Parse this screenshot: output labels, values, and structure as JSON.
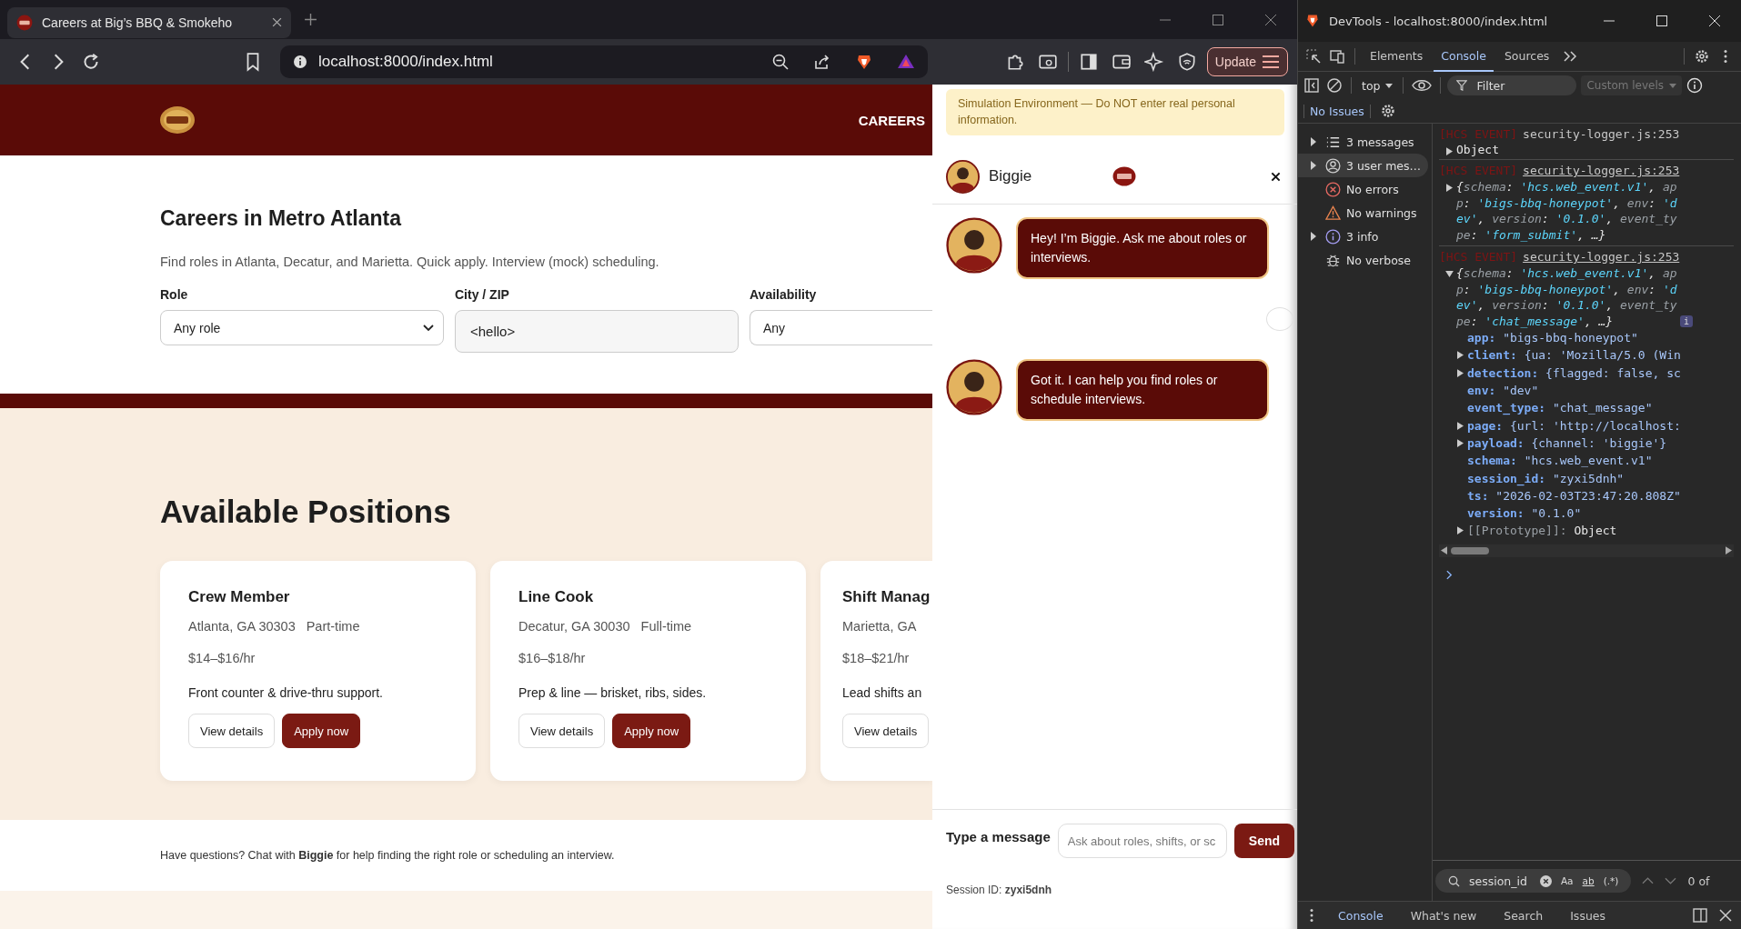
{
  "browser": {
    "tab": {
      "title": "Careers at Big’s BBQ & Smokeho"
    },
    "address": "localhost:8000/index.html",
    "update_button": "Update"
  },
  "page": {
    "nav": {
      "link": "CAREERS"
    },
    "search": {
      "title": "Careers in Metro Atlanta",
      "subtitle": "Find roles in Atlanta, Decatur, and Marietta. Quick apply. Interview (mock) scheduling.",
      "fields": [
        {
          "label": "Role",
          "kind": "select",
          "value": "Any role"
        },
        {
          "label": "City / ZIP",
          "kind": "text",
          "value": "<hello>"
        },
        {
          "label": "Availability",
          "kind": "select",
          "value": "Any"
        }
      ]
    },
    "positions": {
      "title": "Available Positions",
      "cards": [
        {
          "title": "Crew Member",
          "location": "Atlanta, GA 30303",
          "type": "Part-time",
          "pay": "$14–$16/hr",
          "description": "Front counter & drive-thru support.",
          "buttons": [
            {
              "label": "View details",
              "kind": "secondary"
            },
            {
              "label": "Apply now",
              "kind": "primary"
            }
          ]
        },
        {
          "title": "Line Cook",
          "location": "Decatur, GA 30030",
          "type": "Full-time",
          "pay": "$16–$18/hr",
          "description": "Prep & line — brisket, ribs, sides.",
          "buttons": [
            {
              "label": "View details",
              "kind": "secondary"
            },
            {
              "label": "Apply now",
              "kind": "primary"
            }
          ]
        },
        {
          "title": "Shift Manag",
          "location": "Marietta, GA",
          "pay": "$18–$21/hr",
          "description": "Lead shifts an",
          "buttons": [
            {
              "label": "View details",
              "kind": "secondary"
            }
          ]
        }
      ]
    },
    "footer": {
      "text": "Have questions? Chat with **Biggie** for help finding the right role or scheduling an interview."
    }
  },
  "chat": {
    "notice": "Simulation Environment — Do NOT enter real personal information.",
    "agent_name": "Biggie",
    "messages": [
      {
        "kind": "bot",
        "text": "Hey! I’m Biggie. Ask me about roles or interviews."
      },
      {
        "kind": "empty"
      },
      {
        "kind": "bot",
        "text": "Got it. I can help you find roles or schedule interviews."
      }
    ],
    "input_label": "Type a message",
    "input_placeholder": "Ask about roles, shifts, or sc",
    "send_button": "Send",
    "session_label": "Session ID:",
    "session_id": "zyxi5dnh"
  },
  "devtools": {
    "title": "DevTools - localhost:8000/index.html",
    "tabs": [
      {
        "label": "Elements",
        "selected": false
      },
      {
        "label": "Console",
        "selected": true
      },
      {
        "label": "Sources",
        "selected": false
      }
    ],
    "context": "top",
    "filter_placeholder": "Filter",
    "levels": "Custom levels",
    "issues": "No Issues",
    "sidebar": [
      {
        "label": "3 messages",
        "expandable": true,
        "selected": false
      },
      {
        "label": "3 user mes…",
        "expandable": true,
        "selected": true
      },
      {
        "label": "No errors",
        "expandable": false,
        "selected": false
      },
      {
        "label": "No warnings",
        "expandable": false,
        "selected": false
      },
      {
        "label": "3 info",
        "expandable": true,
        "selected": false
      },
      {
        "label": "No verbose",
        "expandable": false,
        "selected": false
      }
    ],
    "entries": [
      {
        "tag": "[HCS EVENT]",
        "source": "security-logger.js:253",
        "underlined": false,
        "expanded": false,
        "summary": "Object"
      },
      {
        "tag": "[HCS EVENT]",
        "source": "security-logger.js:253",
        "underlined": true,
        "expanded": false,
        "preview": [
          {
            "kind": "punct",
            "t": "{"
          },
          {
            "kind": "key",
            "t": "schema"
          },
          {
            "kind": "punct",
            "t": ": "
          },
          {
            "kind": "str",
            "t": "'hcs.web_event.v1'"
          },
          {
            "kind": "punct",
            "t": ", "
          },
          {
            "kind": "key",
            "t": "app"
          },
          {
            "kind": "punct",
            "t": ": "
          },
          {
            "kind": "str",
            "t": "'bigs-bbq-honeypot'"
          },
          {
            "kind": "punct",
            "t": ", "
          },
          {
            "kind": "key",
            "t": "env"
          },
          {
            "kind": "punct",
            "t": ": "
          },
          {
            "kind": "str",
            "t": "'dev'"
          },
          {
            "kind": "punct",
            "t": ", "
          },
          {
            "kind": "key",
            "t": "version"
          },
          {
            "kind": "punct",
            "t": ": "
          },
          {
            "kind": "str",
            "t": "'0.1.0'"
          },
          {
            "kind": "punct",
            "t": ", "
          },
          {
            "kind": "key",
            "t": "event_type"
          },
          {
            "kind": "punct",
            "t": ": "
          },
          {
            "kind": "str",
            "t": "'form_submit'"
          },
          {
            "kind": "punct",
            "t": ", …}"
          }
        ]
      },
      {
        "tag": "[HCS EVENT]",
        "source": "security-logger.js:253",
        "underlined": true,
        "expanded": true,
        "badge": "i",
        "preview": [
          {
            "kind": "punct",
            "t": "{"
          },
          {
            "kind": "key",
            "t": "schema"
          },
          {
            "kind": "punct",
            "t": ": "
          },
          {
            "kind": "str",
            "t": "'hcs.web_event.v1'"
          },
          {
            "kind": "punct",
            "t": ", "
          },
          {
            "kind": "key",
            "t": "app"
          },
          {
            "kind": "punct",
            "t": ": "
          },
          {
            "kind": "str",
            "t": "'bigs-bbq-honeypot'"
          },
          {
            "kind": "punct",
            "t": ", "
          },
          {
            "kind": "key",
            "t": "env"
          },
          {
            "kind": "punct",
            "t": ": "
          },
          {
            "kind": "str",
            "t": "'dev'"
          },
          {
            "kind": "punct",
            "t": ", "
          },
          {
            "kind": "key",
            "t": "version"
          },
          {
            "kind": "punct",
            "t": ": "
          },
          {
            "kind": "str",
            "t": "'0.1.0'"
          },
          {
            "kind": "punct",
            "t": ", "
          },
          {
            "kind": "key",
            "t": "event_type"
          },
          {
            "kind": "punct",
            "t": ": "
          },
          {
            "kind": "str",
            "t": "'chat_message'"
          },
          {
            "kind": "punct",
            "t": ", …}"
          }
        ],
        "properties": [
          {
            "key": "app:",
            "value": "\"bigs-bbq-honeypot\"",
            "kind": "own",
            "expandable": false
          },
          {
            "key": "client:",
            "value": "{ua: 'Mozilla/5.0 (Win",
            "kind": "own",
            "expandable": true
          },
          {
            "key": "detection:",
            "value": "{flagged: false, sc",
            "kind": "own",
            "expandable": true
          },
          {
            "key": "env:",
            "value": "\"dev\"",
            "kind": "own",
            "expandable": false
          },
          {
            "key": "event_type:",
            "value": "\"chat_message\"",
            "kind": "own",
            "expandable": false
          },
          {
            "key": "page:",
            "value": "{url: 'http://localhost:",
            "kind": "own",
            "expandable": true
          },
          {
            "key": "payload:",
            "value": "{channel: 'biggie'}",
            "kind": "own",
            "expandable": true
          },
          {
            "key": "schema:",
            "value": "\"hcs.web_event.v1\"",
            "kind": "own",
            "expandable": false
          },
          {
            "key": "session_id:",
            "value": "\"zyxi5dnh\"",
            "kind": "own",
            "expandable": false
          },
          {
            "key": "ts:",
            "value": "\"2026-02-03T23:47:20.808Z\"",
            "kind": "own",
            "expandable": false
          },
          {
            "key": "version:",
            "value": "\"0.1.0\"",
            "kind": "own",
            "expandable": false
          },
          {
            "key": "[[Prototype]]:",
            "value": "Object",
            "kind": "internal",
            "expandable": true
          }
        ]
      }
    ],
    "search": {
      "value": "session_id",
      "case": "Aa",
      "word": "ab",
      "regex": "(.*)",
      "result": "0 of"
    },
    "drawer_tabs": [
      {
        "label": "Console",
        "selected": true
      },
      {
        "label": "What's new",
        "selected": false
      },
      {
        "label": "Search",
        "selected": false
      },
      {
        "label": "Issues",
        "selected": false
      }
    ]
  }
}
